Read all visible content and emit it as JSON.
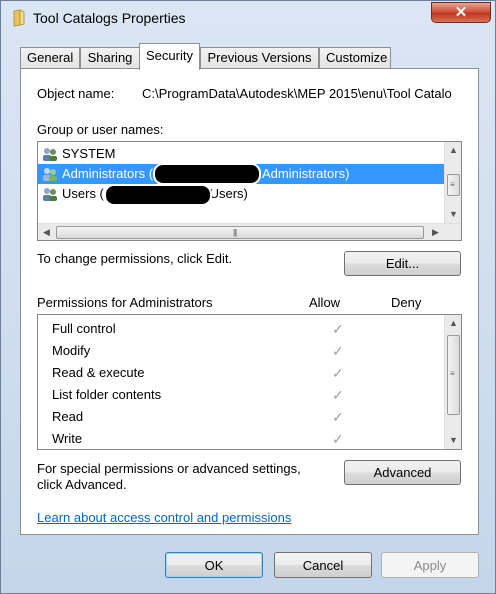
{
  "window": {
    "title": "Tool Catalogs Properties",
    "close_glyph": "✕"
  },
  "tabs": [
    {
      "label": "General"
    },
    {
      "label": "Sharing"
    },
    {
      "label": "Security",
      "active": true
    },
    {
      "label": "Previous Versions"
    },
    {
      "label": "Customize"
    }
  ],
  "security": {
    "object_name_label": "Object name:",
    "object_name_value": "C:\\ProgramData\\Autodesk\\MEP 2015\\enu\\Tool Catalo",
    "group_label": "Group or user names:",
    "users": [
      {
        "prefix": "SYSTEM",
        "suffix": ""
      },
      {
        "prefix": "Administrators (",
        "suffix": "Administrators)",
        "selected": true
      },
      {
        "prefix": "Users (",
        "suffix": "\\Users)"
      }
    ],
    "change_text": "To change permissions, click Edit.",
    "edit_button": "Edit...",
    "permissions_header": "Permissions for Administrators",
    "allow_header": "Allow",
    "deny_header": "Deny",
    "permissions": [
      {
        "name": "Full control",
        "allow": "✓"
      },
      {
        "name": "Modify",
        "allow": "✓"
      },
      {
        "name": "Read & execute",
        "allow": "✓"
      },
      {
        "name": "List folder contents",
        "allow": "✓"
      },
      {
        "name": "Read",
        "allow": "✓"
      },
      {
        "name": "Write",
        "allow": "✓"
      }
    ],
    "special_text_line1": "For special permissions or advanced settings,",
    "special_text_line2": "click Advanced.",
    "advanced_button": "Advanced",
    "learn_link": "Learn about access control and permissions"
  },
  "footer": {
    "ok": "OK",
    "cancel": "Cancel",
    "apply": "Apply"
  },
  "scroll": {
    "up": "▲",
    "down": "▼",
    "left": "◀",
    "right": "▶",
    "grip_v": "≡",
    "grip_h": "|||"
  },
  "colors": {
    "selection": "#3399ff",
    "link": "#0066cc",
    "close": "#c0341d"
  }
}
